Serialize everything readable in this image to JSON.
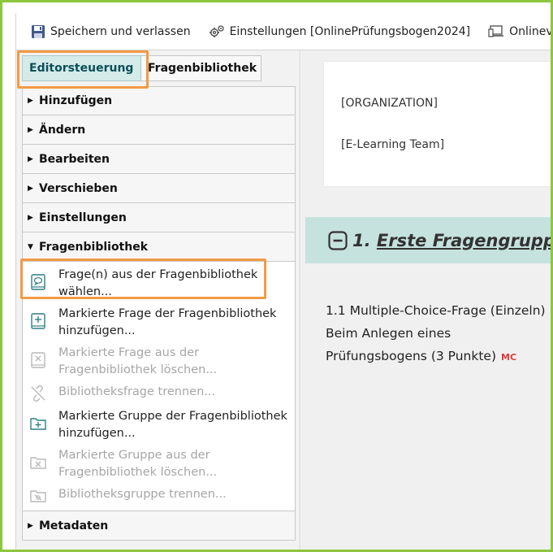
{
  "toolbar": {
    "save_label": "Speichern und verlassen",
    "settings_label": "Einstellungen [OnlinePrüfungsbogen2024]",
    "online_label": "Onlinevo"
  },
  "tabs": [
    {
      "label": "Editorsteuerung",
      "active": true
    },
    {
      "label": "Fragenbibliothek",
      "active": false
    }
  ],
  "sections": [
    {
      "label": "Hinzufügen",
      "expanded": false
    },
    {
      "label": "Ändern",
      "expanded": false
    },
    {
      "label": "Bearbeiten",
      "expanded": false
    },
    {
      "label": "Verschieben",
      "expanded": false
    },
    {
      "label": "Einstellungen",
      "expanded": false
    },
    {
      "label": "Fragenbibliothek",
      "expanded": true
    },
    {
      "label": "Metadaten",
      "expanded": false
    }
  ],
  "library_items": [
    {
      "line1": "Frage(n) aus der Fragenbibliothek",
      "line2": "wählen...",
      "enabled": true,
      "icon": "question-book-icon"
    },
    {
      "line1": "Markierte Frage der Fragenbibliothek",
      "line2": "hinzufügen...",
      "enabled": true,
      "icon": "add-to-book-icon"
    },
    {
      "line1": "Markierte Frage aus der",
      "line2": "Fragenbibliothek löschen...",
      "enabled": false,
      "icon": "remove-from-book-icon"
    },
    {
      "line1": "Bibliotheksfrage trennen...",
      "line2": "",
      "enabled": false,
      "icon": "unlink-icon"
    },
    {
      "line1": "Markierte Gruppe der Fragenbibliothek",
      "line2": "hinzufügen...",
      "enabled": true,
      "icon": "add-folder-icon"
    },
    {
      "line1": "Markierte Gruppe aus der",
      "line2": "Fragenbibliothek löschen...",
      "enabled": false,
      "icon": "remove-folder-icon"
    },
    {
      "line1": "Bibliotheksgruppe trennen...",
      "line2": "",
      "enabled": false,
      "icon": "unlink-folder-icon"
    }
  ],
  "header_card": {
    "organization": "[ORGANIZATION]",
    "team": "[E-Learning Team]"
  },
  "group": {
    "number": "1.",
    "name": "Erste Fragengruppe"
  },
  "question": {
    "line1": "1.1 Multiple-Choice-Frage (Einzeln)",
    "line2": "Beim Anlegen eines",
    "line3": "Prüfungsbogens (3 Punkte)",
    "badge": "MC"
  },
  "colors": {
    "highlight": "#f29a45",
    "frame": "#8dc63f",
    "active_tab": "#d4ebea",
    "group_bg": "#c6e2df",
    "badge": "#e13b3b"
  }
}
